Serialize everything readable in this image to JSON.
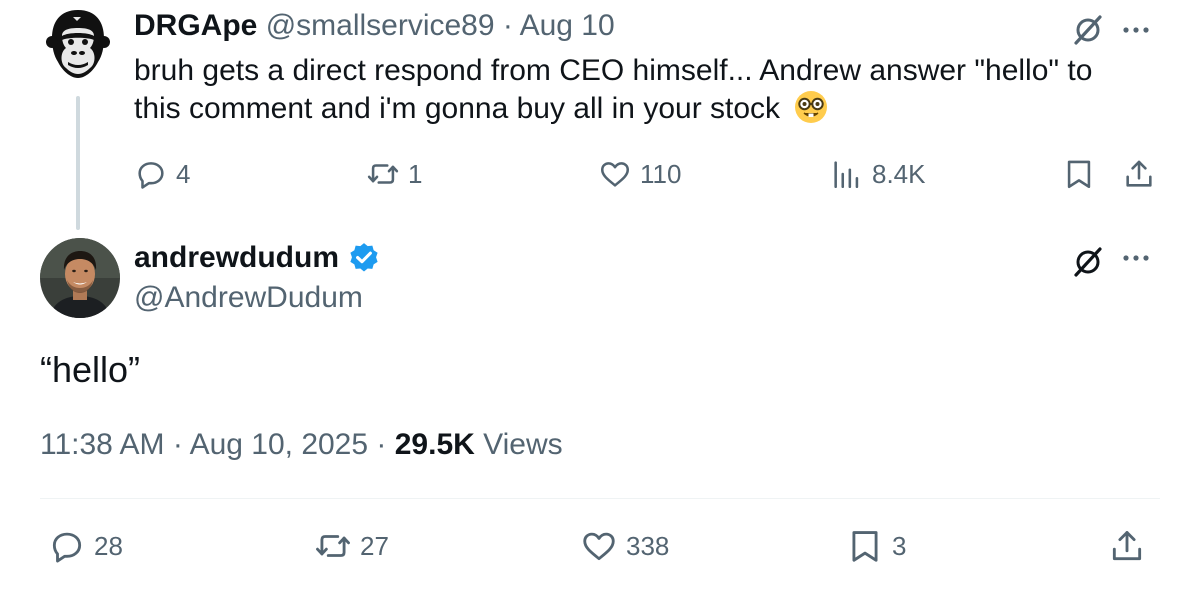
{
  "parent_tweet": {
    "author_name": "DRGApe",
    "handle": "@smallservice89",
    "separator": "·",
    "date": "Aug 10",
    "text": "bruh gets a direct respond from CEO himself... Andrew answer \"hello\" to this comment and i'm gonna buy all in your stock",
    "emoji_icon": "nerd-face-emoji",
    "actions": {
      "replies": "4",
      "reposts": "1",
      "likes": "110",
      "views": "8.4K"
    }
  },
  "reply_tweet": {
    "author_name": "andrewdudum",
    "handle": "@AndrewDudum",
    "verified": true,
    "verified_color": "#1d9bf0",
    "text": "“hello”",
    "time": "11:38 AM",
    "separator": "·",
    "date": "Aug 10, 2025",
    "views_count": "29.5K",
    "views_label": "Views",
    "actions": {
      "replies": "28",
      "reposts": "27",
      "likes": "338",
      "bookmarks": "3"
    }
  },
  "colors": {
    "text_primary": "#0f1419",
    "text_secondary": "#536471",
    "thread_line": "#cfd9de",
    "divider": "#eff3f4"
  }
}
